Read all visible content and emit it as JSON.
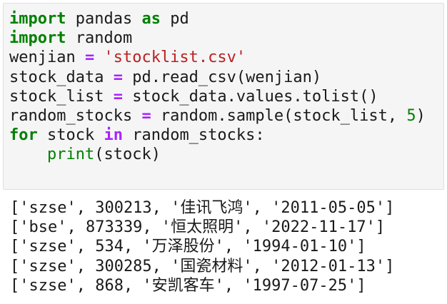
{
  "code_cell": {
    "lines": [
      {
        "tokens": [
          [
            "kw",
            "import"
          ],
          [
            "t",
            " pandas "
          ],
          [
            "kw",
            "as"
          ],
          [
            "t",
            " pd"
          ]
        ]
      },
      {
        "tokens": [
          [
            "kw",
            "import"
          ],
          [
            "t",
            " random"
          ]
        ]
      },
      {
        "tokens": [
          [
            "t",
            "wenjian "
          ],
          [
            "op",
            "="
          ],
          [
            "t",
            " "
          ],
          [
            "str",
            "'stocklist.csv'"
          ]
        ]
      },
      {
        "tokens": [
          [
            "t",
            "stock_data "
          ],
          [
            "op",
            "="
          ],
          [
            "t",
            " pd.read_csv(wenjian)"
          ]
        ]
      },
      {
        "tokens": [
          [
            "t",
            "stock_list "
          ],
          [
            "op",
            "="
          ],
          [
            "t",
            " stock_data.values.tolist()"
          ]
        ]
      },
      {
        "tokens": [
          [
            "t",
            "random_stocks "
          ],
          [
            "op",
            "="
          ],
          [
            "t",
            " random.sample(stock_list, "
          ],
          [
            "num",
            "5"
          ],
          [
            "t",
            ")"
          ]
        ]
      },
      {
        "tokens": [
          [
            "kw",
            "for"
          ],
          [
            "t",
            " stock "
          ],
          [
            "op",
            "in"
          ],
          [
            "t",
            " random_stocks:"
          ]
        ]
      },
      {
        "tokens": [
          [
            "t",
            "    "
          ],
          [
            "bi",
            "print"
          ],
          [
            "t",
            "(stock)"
          ]
        ]
      }
    ]
  },
  "output": {
    "lines": [
      "['szse', 300213, '佳讯飞鸿', '2011-05-05']",
      "['bse', 873339, '恒太照明', '2022-11-17']",
      "['szse', 534, '万泽股份', '1994-01-10']",
      "['szse', 300285, '国瓷材料', '2012-01-13']",
      "['szse', 868, '安凯客车', '1997-07-25']"
    ]
  },
  "colors": {
    "keyword": "#008000",
    "operator": "#aa22ff",
    "string": "#ba2121",
    "number": "#008000",
    "builtin": "#008000",
    "cell_background": "#f5f5f5"
  }
}
